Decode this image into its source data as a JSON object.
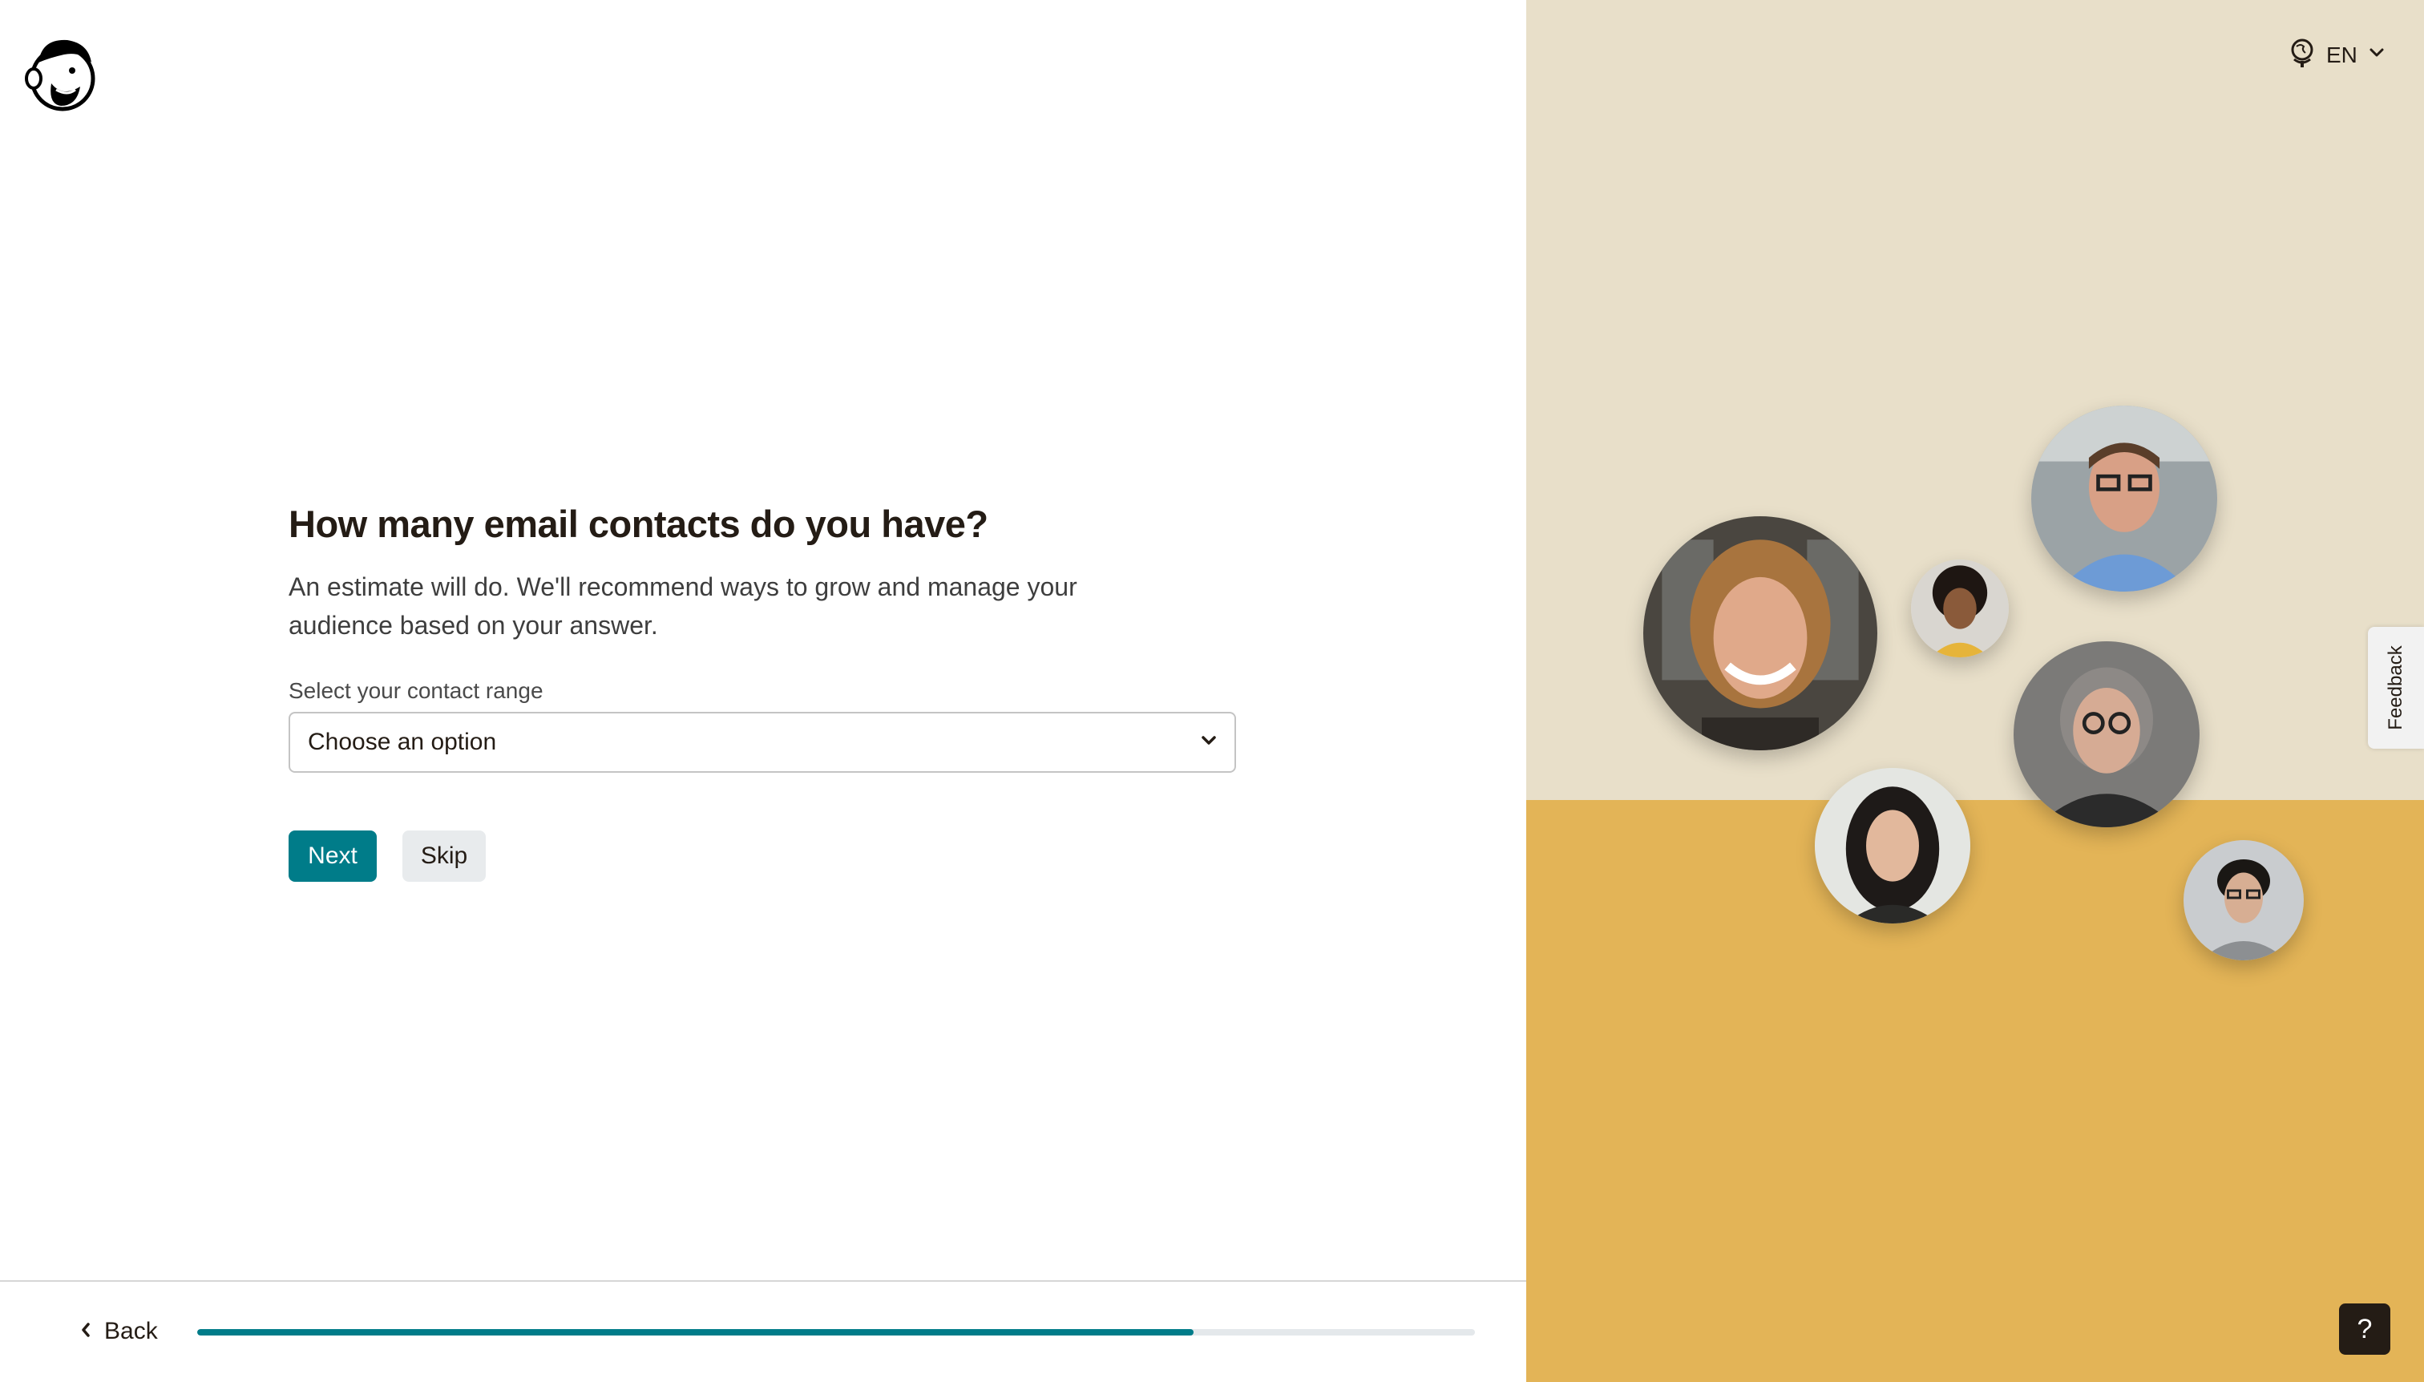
{
  "header": {
    "logo_icon": "mailchimp-freddie-logo",
    "language": "EN",
    "language_icon": "globe-icon"
  },
  "question": {
    "title": "How many email contacts do you have?",
    "description": "An estimate will do. We'll recommend ways to grow and manage your audience based on your answer.",
    "field_label": "Select your contact range",
    "select_value": "Choose an option"
  },
  "actions": {
    "next_label": "Next",
    "skip_label": "Skip"
  },
  "footer": {
    "back_label": "Back",
    "progress_fraction": 0.78
  },
  "side_panel": {
    "feedback_label": "Feedback",
    "help_label": "?"
  },
  "colors": {
    "accent": "#007c89",
    "panel_top": "#e8dfc9",
    "panel_bottom": "#e3b457",
    "text": "#241c15"
  }
}
